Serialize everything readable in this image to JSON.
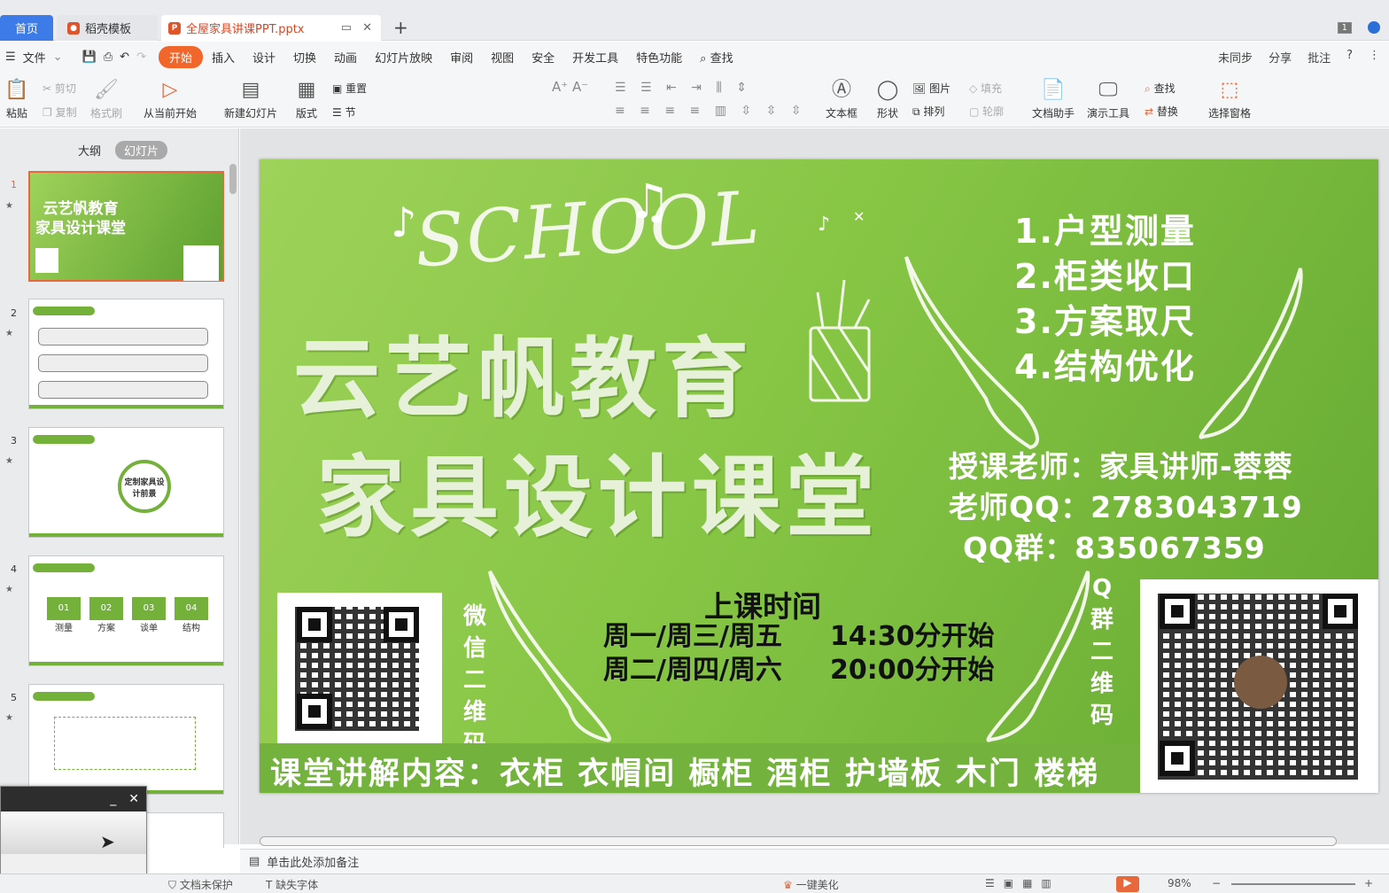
{
  "tabs": {
    "home": "首页",
    "docer": "稻壳模板",
    "doc": "全屋家具讲课PPT.pptx",
    "badge": "1"
  },
  "menu": {
    "file": "文件",
    "items": [
      "开始",
      "插入",
      "设计",
      "切换",
      "动画",
      "幻灯片放映",
      "审阅",
      "视图",
      "安全",
      "开发工具",
      "特色功能"
    ],
    "search": "查找",
    "right": [
      "未同步",
      "分享",
      "批注"
    ]
  },
  "toolbar": {
    "paste": "粘贴",
    "cut": "剪切",
    "copy": "复制",
    "format_painter": "格式刷",
    "play_from_current": "从当前开始",
    "new_slide": "新建幻灯片",
    "layout": "版式",
    "reset": "重置",
    "section": "节",
    "font_size": "0",
    "textbox": "文本框",
    "shape": "形状",
    "picture": "图片",
    "fill": "填充",
    "arrange": "排列",
    "outline": "轮廓",
    "doc_helper": "文档助手",
    "presenter_tools": "演示工具",
    "find": "查找",
    "replace": "替换",
    "select_pane": "选择窗格"
  },
  "panel": {
    "outline_tab": "大纲",
    "slides_tab": "幻灯片",
    "numbers": [
      "1",
      "2",
      "3",
      "4",
      "5"
    ],
    "thumb1": {
      "l1": "云艺帆教育",
      "l2": "家具设计课堂"
    },
    "thumb3": {
      "center": "定制家具设计前景"
    },
    "thumb4": {
      "nums": [
        "01",
        "02",
        "03",
        "04"
      ],
      "labels": [
        "测量",
        "方案",
        "谈单",
        "结构"
      ]
    }
  },
  "slide": {
    "school": "SCHOOL",
    "title1": "云艺帆教育",
    "title2": "家具设计课堂",
    "topics": [
      "1.户型测量",
      "2.柜类收口",
      "3.方案取尺",
      "4.结构优化"
    ],
    "teacher": "授课老师：家具讲师-蓉蓉",
    "teacher_qq": "老师QQ：2783043719",
    "qq_group": "QQ群：835067359",
    "schedule_title": "上课时间",
    "schedule": [
      {
        "days": "周一/周三/周五",
        "time": "14:30分开始"
      },
      {
        "days": "周二/周四/周六",
        "time": "20:00分开始"
      }
    ],
    "wechat_label": [
      "微",
      "信",
      "二",
      "维",
      "码"
    ],
    "qq_label": [
      "Q",
      "群",
      "二",
      "维",
      "码"
    ],
    "course_content": "课堂讲解内容：衣柜 衣帽间 橱柜  酒柜  护墙板 木门 楼梯"
  },
  "notes_placeholder": "单击此处添加备注",
  "status": {
    "backup": "文档未保护",
    "font": "缺失字体",
    "beautify": "一键美化",
    "zoom": "98%"
  },
  "colors": {
    "accent": "#f1662b",
    "slide_green": "#86c544",
    "home_tab": "#3d7ce8"
  }
}
